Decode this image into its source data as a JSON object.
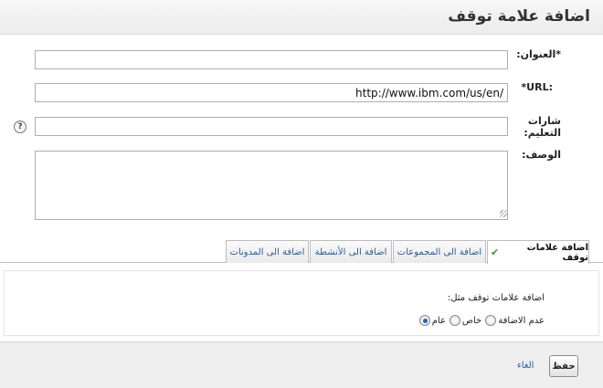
{
  "dialog": {
    "title": "اضافة علامة توقف"
  },
  "form": {
    "title_label": "*العنوان:",
    "title_value": "",
    "url_label": "*URL:",
    "url_value": "http://www.ibm.com/us/en/",
    "tags_label": "شارات التعليم:",
    "tags_value": "",
    "help_icon": "?",
    "description_label": "الوصف:",
    "description_value": ""
  },
  "tabs": [
    {
      "label": "اضافة علامات توقف",
      "active": true,
      "icon": "check-icon"
    },
    {
      "label": "اضافة الى المجموعات",
      "active": false
    },
    {
      "label": "اضافة الى الأنشطة",
      "active": false
    },
    {
      "label": "اضافة الى المدونات",
      "active": false
    }
  ],
  "check_glyph": "✔",
  "panel": {
    "heading": "اضافة علامات توقف مثل:",
    "options": [
      {
        "label": "عام",
        "selected": true
      },
      {
        "label": "خاص",
        "selected": false
      },
      {
        "label": "عدم الاضافة",
        "selected": false
      }
    ]
  },
  "footer": {
    "save_label": "حفظ",
    "cancel_label": "الغاء"
  },
  "colors": {
    "link": "#2d5c94",
    "radio_selected": "#1f63c4",
    "check": "#3a9a2f"
  }
}
